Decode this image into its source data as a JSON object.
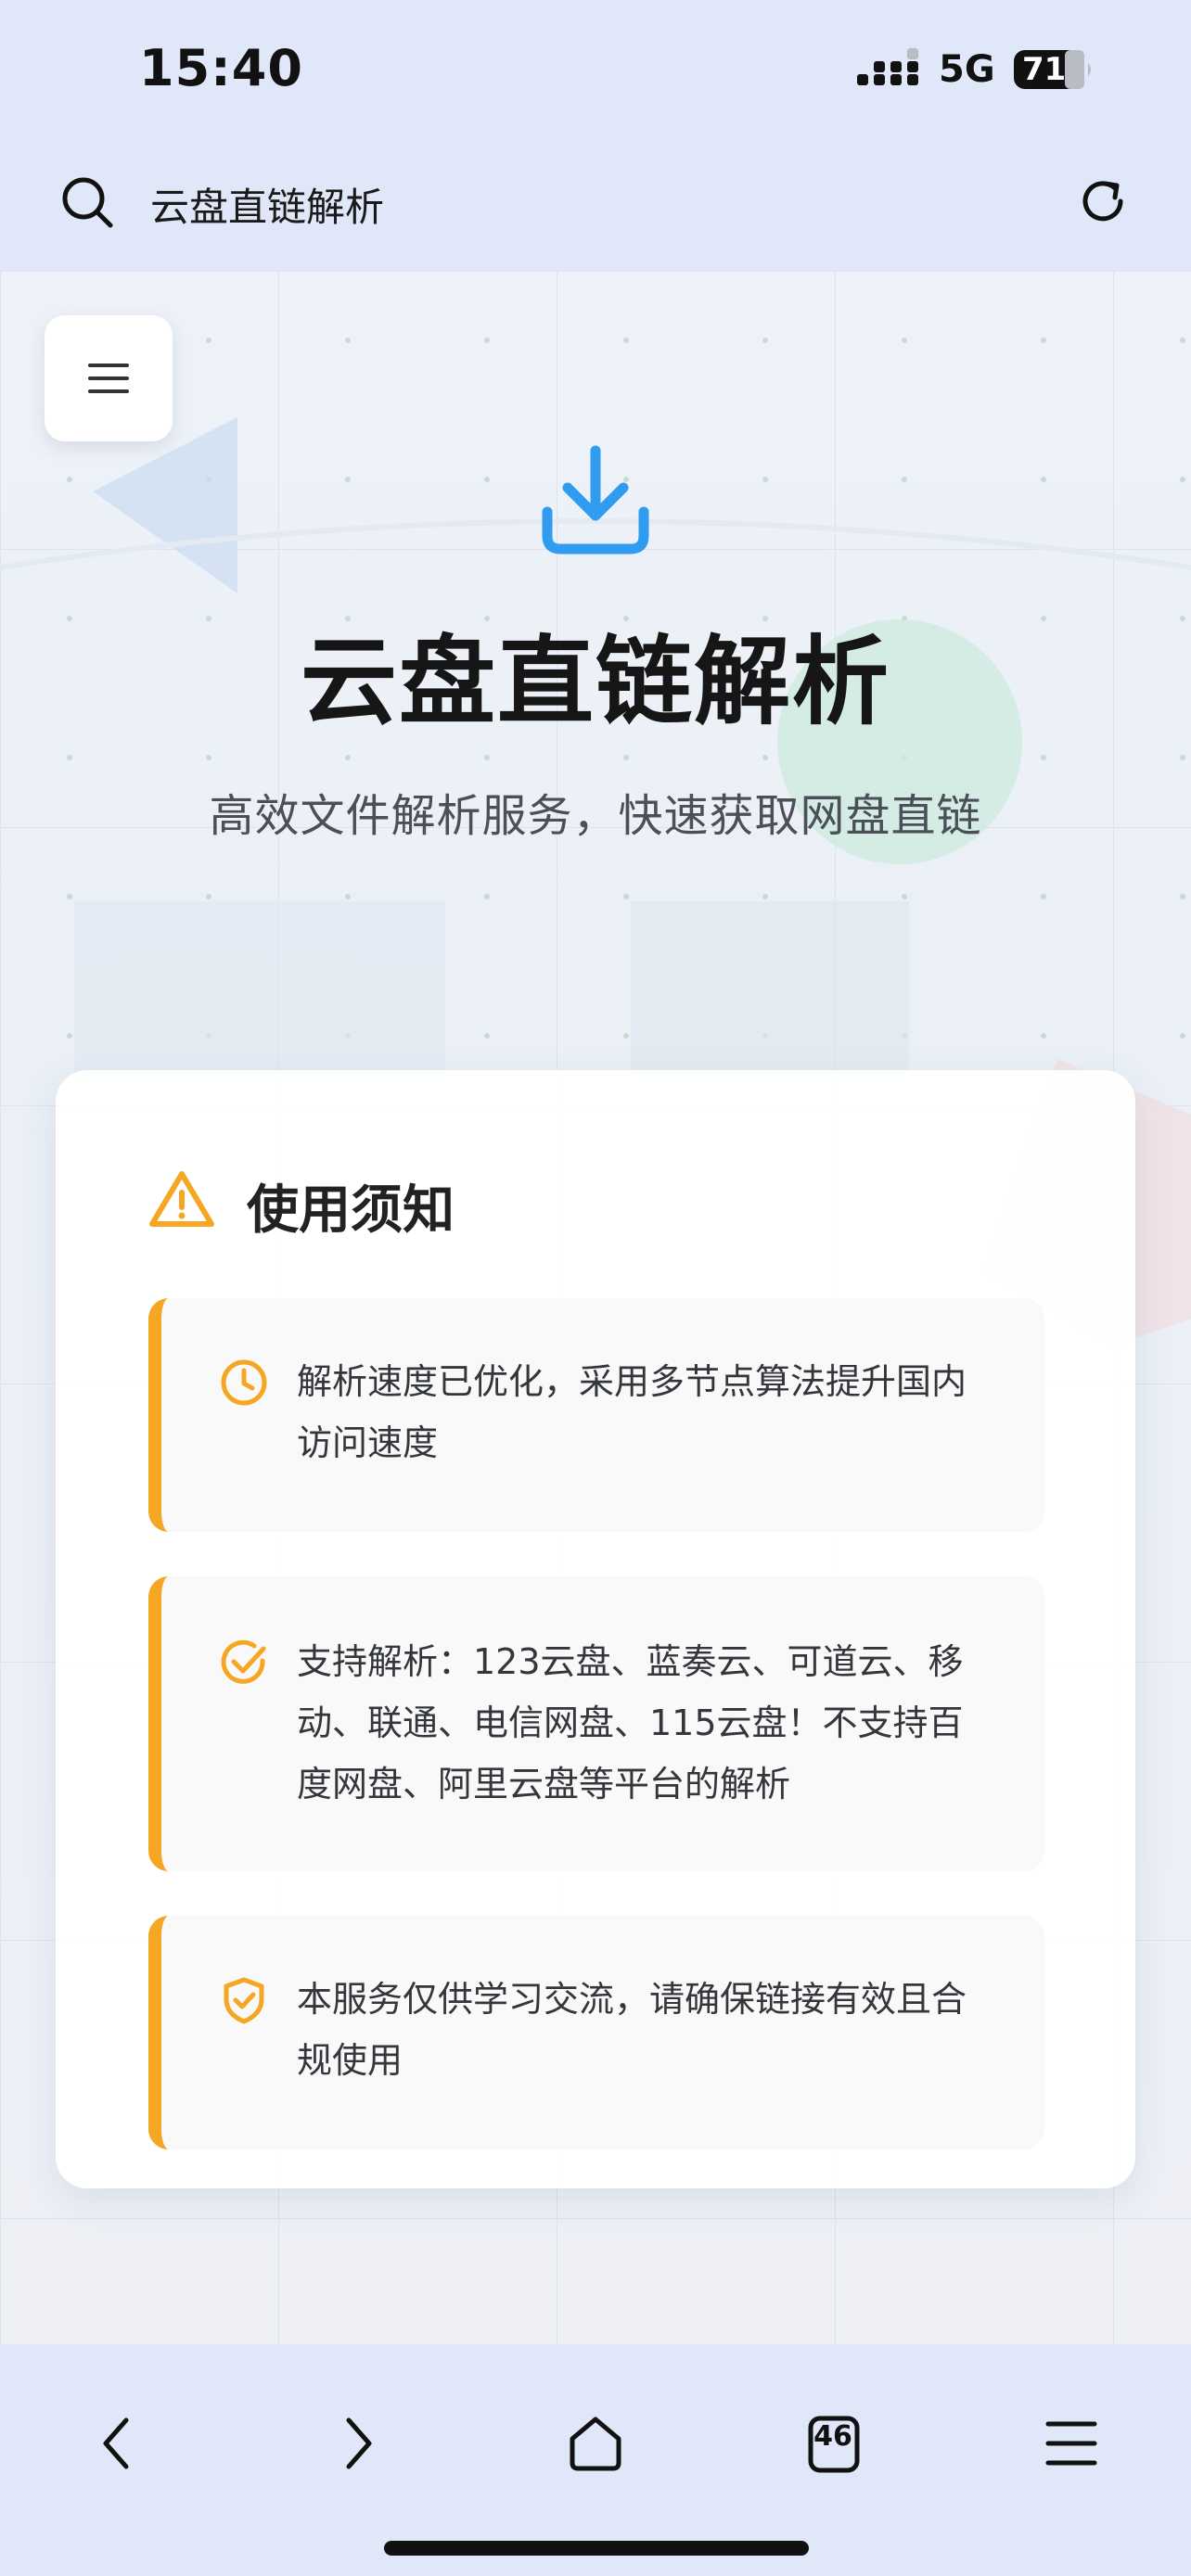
{
  "status_bar": {
    "time": "15:40",
    "network": "5G",
    "battery": "71"
  },
  "url_bar": {
    "title": "云盘直链解析"
  },
  "hero": {
    "title": "云盘直链解析",
    "subtitle": "高效文件解析服务，快速获取网盘直链"
  },
  "notice": {
    "title": "使用须知",
    "items": [
      {
        "icon": "clock-icon",
        "text": "解析速度已优化，采用多节点算法提升国内访问速度"
      },
      {
        "icon": "check-circle-icon",
        "text": "支持解析：123云盘、蓝奏云、可道云、移动、联通、电信网盘、115云盘！不支持百度网盘、阿里云盘等平台的解析"
      },
      {
        "icon": "shield-check-icon",
        "text": "本服务仅供学习交流，请确保链接有效且合规使用"
      }
    ]
  },
  "bottom_nav": {
    "tab_count": "46"
  },
  "colors": {
    "accent_blue": "#2f9cf0",
    "warning_orange": "#f5a623",
    "chrome_background": "#dfe7f8"
  }
}
